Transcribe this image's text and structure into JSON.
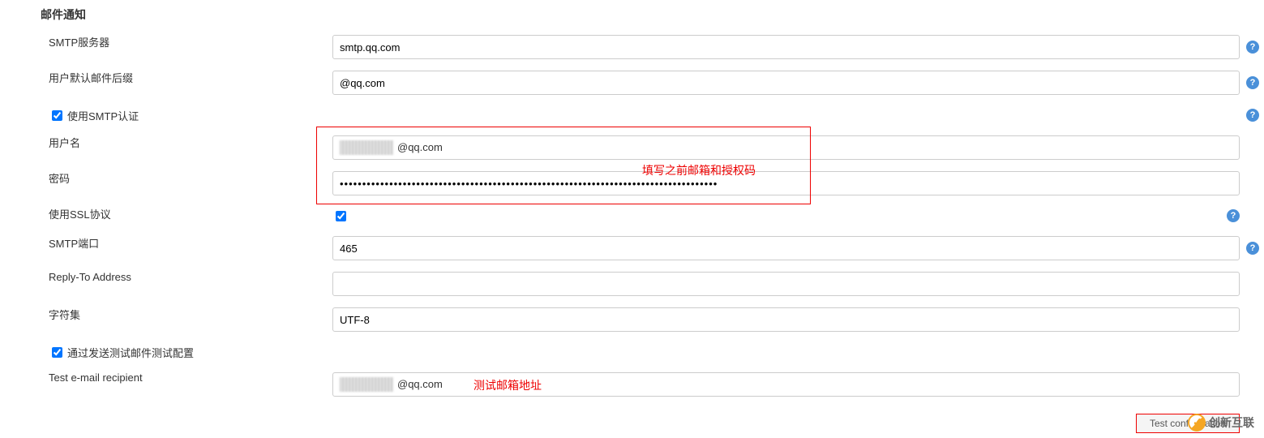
{
  "section": {
    "title": "邮件通知"
  },
  "fields": {
    "smtp_server": {
      "label": "SMTP服务器",
      "value": "smtp.qq.com"
    },
    "default_suffix": {
      "label": "用户默认邮件后缀",
      "value": "@qq.com"
    },
    "use_smtp_auth": {
      "label": "使用SMTP认证",
      "checked": true
    },
    "username": {
      "label": "用户名",
      "value_suffix": "@qq.com"
    },
    "password": {
      "label": "密码",
      "value": "••••••••••••••••••••••••••••••••••••••••••••••••••••••••••••••••••••••••••••••••••••"
    },
    "use_ssl": {
      "label": "使用SSL协议",
      "checked": true
    },
    "smtp_port": {
      "label": "SMTP端口",
      "value": "465"
    },
    "reply_to": {
      "label": "Reply-To Address",
      "value": ""
    },
    "charset": {
      "label": "字符集",
      "value": "UTF-8"
    },
    "test_config": {
      "label": "通过发送测试邮件测试配置",
      "checked": true
    },
    "test_recipient": {
      "label": "Test e-mail recipient",
      "value_suffix": "@qq.com"
    }
  },
  "buttons": {
    "test_configuration": "Test configuration"
  },
  "annotations": {
    "fill_email_auth": "填写之前邮箱和授权码",
    "test_email_addr": "测试邮箱地址"
  },
  "watermark": {
    "text": "创新互联"
  },
  "help_icon": "?"
}
